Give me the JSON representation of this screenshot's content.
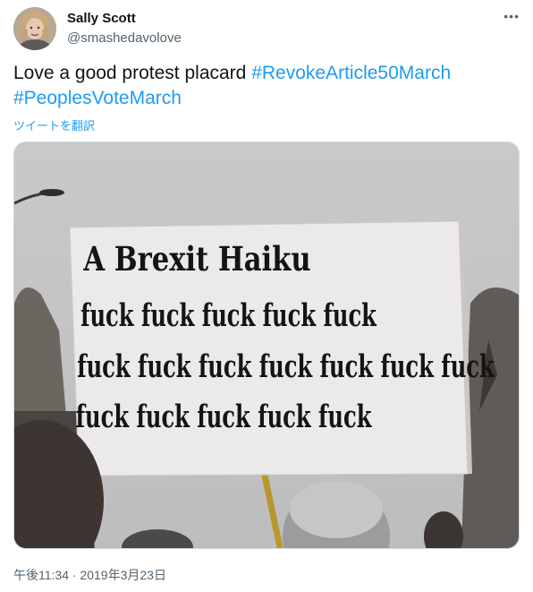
{
  "author": {
    "name": "Sally Scott",
    "handle": "@smashedavolove"
  },
  "tweet": {
    "text_plain": "Love a good protest placard ",
    "hashtags": [
      "#RevokeArticle50March",
      "#PeoplesVoteMarch"
    ],
    "translate_label": "ツイートを翻訳",
    "timestamp": "午後11:34 · 2019年3月23日"
  },
  "media": {
    "sign_title": "A Brexit Haiku",
    "sign_lines": [
      "fuck fuck fuck fuck fuck",
      "fuck fuck fuck fuck fuck fuck fuck",
      "fuck fuck fuck fuck fuck"
    ]
  },
  "icons": {
    "more": "more-icon",
    "avatar": "avatar-image"
  },
  "colors": {
    "accent": "#1d9bf0",
    "text_secondary": "#536471"
  }
}
